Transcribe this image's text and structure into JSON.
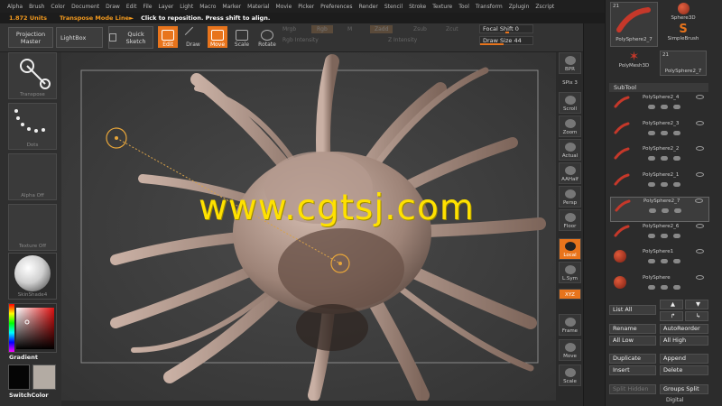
{
  "menu": [
    "Alpha",
    "Brush",
    "Color",
    "Document",
    "Draw",
    "Edit",
    "File",
    "Layer",
    "Light",
    "Macro",
    "Marker",
    "Material",
    "Movie",
    "Picker",
    "Preferences",
    "Render",
    "Stencil",
    "Stroke",
    "Texture",
    "Tool",
    "Transform",
    "Zplugin",
    "Zscript"
  ],
  "status": {
    "units": "1.872 Units",
    "mode": "Transpose Mode Line►",
    "hint": "Click to reposition. Press shift to align."
  },
  "toolbar": {
    "projection_master": "Projection Master",
    "lightbox": "LightBox",
    "quick_sketch": "Quick Sketch",
    "edit": "Edit",
    "draw": "Draw",
    "move": "Move",
    "scale": "Scale",
    "rotate": "Rotate",
    "mrgb": "Mrgb",
    "rgb": "Rgb",
    "m": "M",
    "zadd": "Zadd",
    "zsub": "Zsub",
    "zcut": "Zcut",
    "rgb_intensity": "Rgb Intensity",
    "z_intensity": "Z Intensity",
    "focal_shift_label": "Focal Shift",
    "focal_shift_value": "0",
    "draw_size_label": "Draw Size",
    "draw_size_value": "44",
    "draw_size_fraction": 0.44
  },
  "left_shelf": {
    "transpose": "Transpose",
    "dots": "Dots",
    "alpha": "Alpha Off",
    "texture": "Texture Off",
    "material": "SkinShade4",
    "gradient": "Gradient",
    "switch_color": "SwitchColor"
  },
  "right_tools": [
    "BPR",
    "SPix 3",
    "Scroll",
    "Zoom",
    "Actual",
    "AAHalf",
    "Persp",
    "Floor",
    "Local",
    "L.Sym",
    "XYZ",
    "Frame",
    "Move",
    "Scale"
  ],
  "tool_thumbs": {
    "top_count": "21",
    "sphere3d": "Sphere3D",
    "polysphere_top": "PolySphere2_7",
    "simplebrush": "SimpleBrush",
    "polymesh3d": "PolyMesh3D",
    "polysphere_bottom": "PolySphere2_7",
    "bottom_count": "21"
  },
  "subtool": {
    "header": "SubTool",
    "items": [
      "PolySphere2_4",
      "PolySphere2_3",
      "PolySphere2_2",
      "PolySphere2_1",
      "PolySphere2_7",
      "PolySphere2_6",
      "PolySphere1",
      "PolySphere"
    ]
  },
  "subtool_buttons": {
    "list_all": "List All",
    "rename": "Rename",
    "auto_reorder": "AutoReorder",
    "all_low": "All Low",
    "all_high": "All High",
    "duplicate": "Duplicate",
    "append": "Append",
    "insert": "Insert",
    "delete": "Delete",
    "split_hidden": "Split Hidden",
    "groups_split": "Groups Split"
  },
  "watermark": "www.cgtsj.com",
  "brand": "Digital",
  "colors": {
    "accent": "#e8741c",
    "watermark": "#ffe100"
  }
}
